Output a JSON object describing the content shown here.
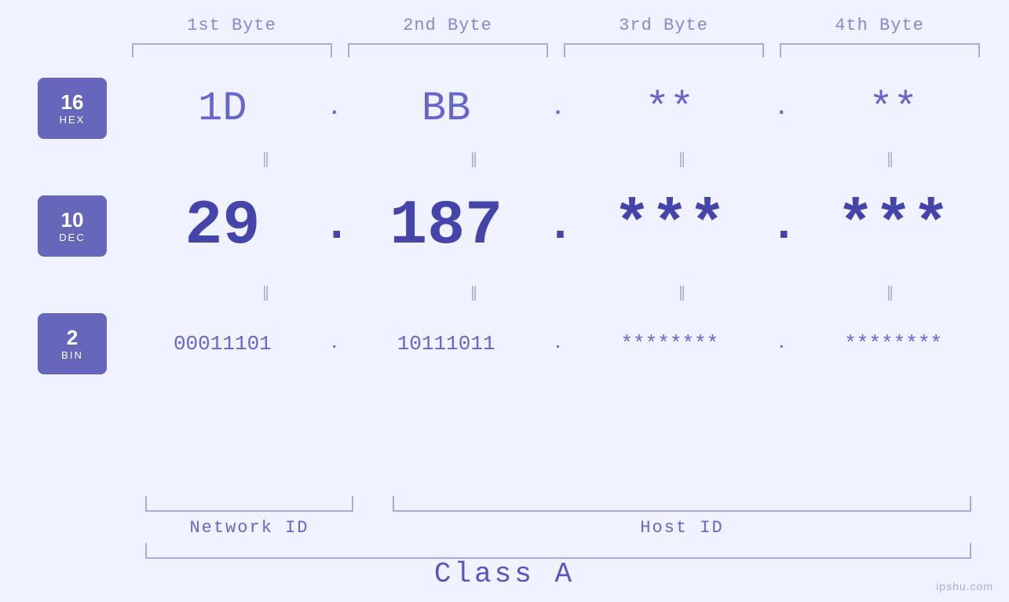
{
  "header": {
    "bytes": [
      "1st Byte",
      "2nd Byte",
      "3rd Byte",
      "4th Byte"
    ]
  },
  "bases": [
    {
      "number": "16",
      "label": "HEX"
    },
    {
      "number": "10",
      "label": "DEC"
    },
    {
      "number": "2",
      "label": "BIN"
    }
  ],
  "hex_values": [
    "1D",
    "BB",
    "**",
    "**"
  ],
  "dec_values": [
    "29",
    "187",
    "***",
    "***"
  ],
  "bin_values": [
    "00011101",
    "10111011",
    "********",
    "********"
  ],
  "dots": ".",
  "equals_sign": "||",
  "labels": {
    "network_id": "Network ID",
    "host_id": "Host ID",
    "class": "Class A"
  },
  "watermark": "ipshu.com"
}
